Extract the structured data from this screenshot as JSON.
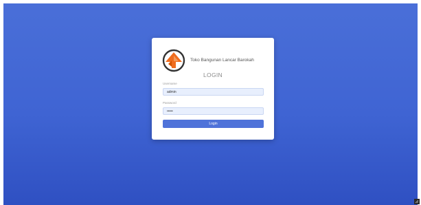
{
  "brand": {
    "name": "Toko Bangunan Lancar Barokah",
    "logo_icon": "orange-house-logo-icon"
  },
  "login": {
    "title": "LOGIN",
    "username_label": "Username",
    "username_value": "admin",
    "password_label": "Password",
    "password_value": "•••••",
    "submit_label": "Login"
  },
  "colors": {
    "background": "#3f64d3",
    "accent": "#4f73d9",
    "logo_orange": "#ef6c1e",
    "logo_dark": "#333333"
  },
  "corner": {
    "icon": "resize-corner-icon"
  }
}
